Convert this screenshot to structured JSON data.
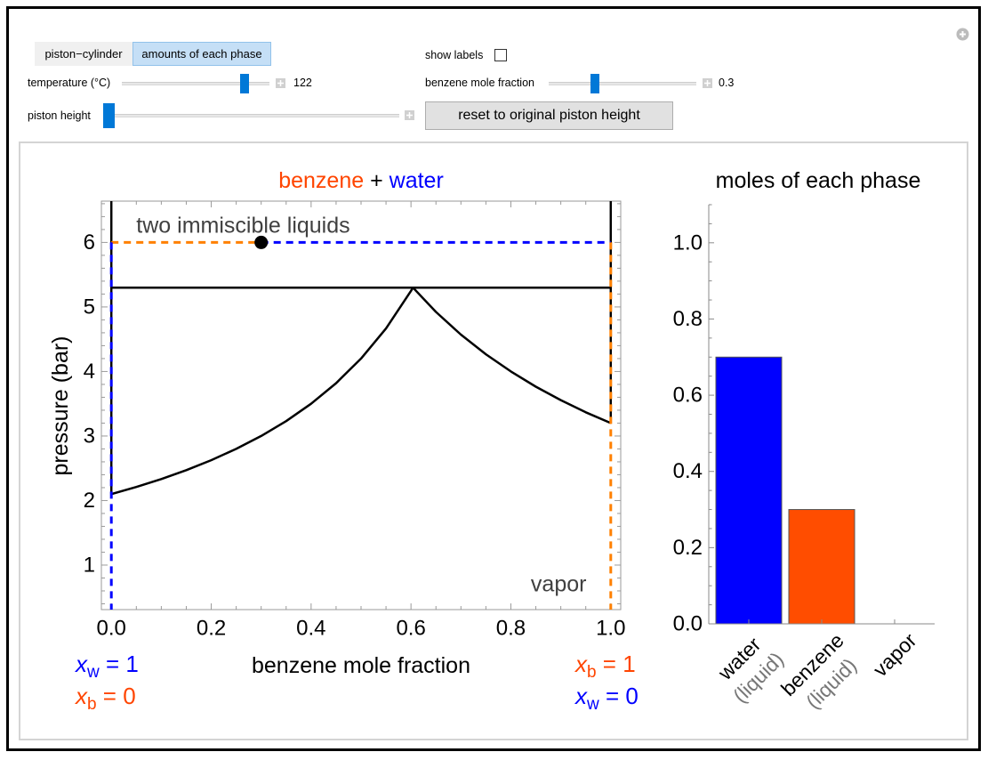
{
  "toolbar": {
    "tabs": [
      {
        "label": "piston−cylinder",
        "selected": false
      },
      {
        "label": "amounts of each phase",
        "selected": true
      }
    ],
    "show_labels": {
      "label": "show labels",
      "checked": false
    },
    "temperature": {
      "label": "temperature (°C)",
      "value": "122",
      "position": 0.85
    },
    "benzene_mole_fraction": {
      "label": "benzene mole fraction",
      "value": "0.3",
      "position": 0.3
    },
    "piston_height": {
      "label": "piston height",
      "position": 0.0
    },
    "reset_button": {
      "label": "reset to original piston height"
    },
    "icons": {
      "slider_expand": "plus-square-icon",
      "panel_options": "plus-circle-icon"
    }
  },
  "colors": {
    "slider_thumb": "#0078d7",
    "selected_tab": "#c5dff6",
    "water": "#0000ff",
    "benzene": "#ff4500",
    "benzene_dashed": "#ff8000",
    "annotation_text": "#404040",
    "sublabel_text": "#777777"
  },
  "chart_data": [
    {
      "type": "line",
      "title_parts": [
        {
          "text": "benzene",
          "color": "#ff4500"
        },
        {
          "text": " + ",
          "color": "#000000"
        },
        {
          "text": "water",
          "color": "#0000ff"
        }
      ],
      "xlabel": "benzene mole fraction",
      "ylabel": "pressure (bar)",
      "xlim": [
        -0.02,
        1.02
      ],
      "ylim": [
        0.31,
        6.64
      ],
      "xticks": [
        0,
        0.2,
        0.4,
        0.6,
        0.8,
        1.0
      ],
      "xtick_labels": [
        "0.0",
        "0.2",
        "0.4",
        "0.6",
        "0.8",
        "1.0"
      ],
      "x_minor_step": 0.05,
      "yticks": [
        1,
        2,
        3,
        4,
        5,
        6
      ],
      "ytick_labels": [
        "1",
        "2",
        "3",
        "4",
        "5",
        "6"
      ],
      "y_minor_step": 0.2,
      "grid": false,
      "series": [
        {
          "name": "water dew curve",
          "style": "solid",
          "color": "#000000",
          "x": [
            0,
            0.05,
            0.1,
            0.15,
            0.2,
            0.25,
            0.3,
            0.35,
            0.4,
            0.45,
            0.5,
            0.55,
            0.6,
            0.604
          ],
          "y": [
            2.1,
            2.211,
            2.333,
            2.471,
            2.625,
            2.8,
            3.0,
            3.231,
            3.5,
            3.818,
            4.2,
            4.667,
            5.25,
            5.3
          ]
        },
        {
          "name": "benzene dew curve",
          "style": "solid",
          "color": "#000000",
          "x": [
            0.604,
            0.65,
            0.7,
            0.75,
            0.8,
            0.85,
            0.9,
            0.95,
            1.0
          ],
          "y": [
            5.3,
            4.923,
            4.571,
            4.267,
            4.0,
            3.765,
            3.556,
            3.368,
            3.2
          ]
        },
        {
          "name": "three-phase line",
          "style": "solid",
          "color": "#000000",
          "x": [
            0,
            1
          ],
          "y": [
            5.3,
            5.3
          ]
        },
        {
          "name": "pure water boundary",
          "style": "solid",
          "color": "#000000",
          "x": [
            0,
            0
          ],
          "y": [
            2.1,
            6.64
          ]
        },
        {
          "name": "pure benzene boundary",
          "style": "solid",
          "color": "#000000",
          "x": [
            1,
            1
          ],
          "y": [
            3.2,
            6.64
          ]
        },
        {
          "name": "benzene lever segment",
          "style": "dashed",
          "color": "#ff8000",
          "x": [
            0,
            0.3
          ],
          "y": [
            6,
            6
          ]
        },
        {
          "name": "water lever segment",
          "style": "dashed",
          "color": "#0000ff",
          "x": [
            0.3,
            1
          ],
          "y": [
            6,
            6
          ]
        },
        {
          "name": "water liquid composition",
          "style": "dashed",
          "color": "#0000ff",
          "x": [
            0,
            0
          ],
          "y": [
            6,
            0.31
          ]
        },
        {
          "name": "benzene liquid composition",
          "style": "dashed",
          "color": "#ff8000",
          "x": [
            1,
            1
          ],
          "y": [
            6,
            0.31
          ]
        }
      ],
      "state_point": {
        "x": 0.3,
        "y": 6.0
      },
      "annotations": [
        {
          "text": "two immiscible liquids",
          "x": 0.05,
          "y": 6.15
        },
        {
          "text": "vapor",
          "x": 0.84,
          "y": 0.59
        }
      ],
      "composition_labels": {
        "left": [
          {
            "symbol": "x",
            "subscript": "w",
            "text": " = 1",
            "color": "#0000ff"
          },
          {
            "symbol": "x",
            "subscript": "b",
            "text": " = 0",
            "color": "#ff4500"
          }
        ],
        "right": [
          {
            "symbol": "x",
            "subscript": "b",
            "text": " = 1",
            "color": "#ff4500"
          },
          {
            "symbol": "x",
            "subscript": "w",
            "text": " = 0",
            "color": "#0000ff"
          }
        ]
      }
    },
    {
      "type": "bar",
      "title": "moles of each phase",
      "categories": [
        "water",
        "benzene",
        "vapor"
      ],
      "category_sublabels": [
        "(liquid)",
        "(liquid)",
        ""
      ],
      "values": [
        0.7,
        0.3,
        0.0
      ],
      "bar_colors": [
        "#0000ff",
        "#ff4d00",
        "#888888"
      ],
      "xlabel": "",
      "ylabel": "",
      "ylim": [
        0,
        1.1
      ],
      "yticks": [
        0,
        0.2,
        0.4,
        0.6,
        0.8,
        1.0
      ],
      "ytick_labels": [
        "0.0",
        "0.2",
        "0.4",
        "0.6",
        "0.8",
        "1.0"
      ],
      "y_minor_step": 0.05,
      "grid": false
    }
  ]
}
